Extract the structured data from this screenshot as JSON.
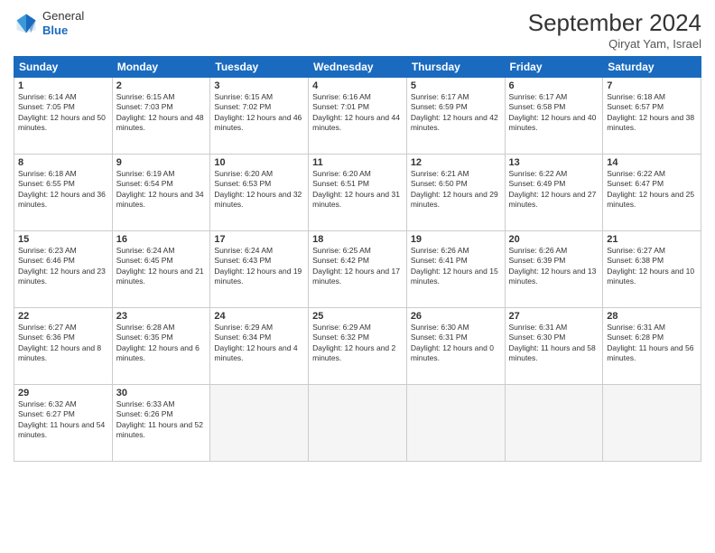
{
  "header": {
    "logo_line1": "General",
    "logo_line2": "Blue",
    "title": "September 2024",
    "subtitle": "Qiryat Yam, Israel"
  },
  "days_of_week": [
    "Sunday",
    "Monday",
    "Tuesday",
    "Wednesday",
    "Thursday",
    "Friday",
    "Saturday"
  ],
  "weeks": [
    [
      {
        "day": "1",
        "rise": "6:14 AM",
        "set": "7:05 PM",
        "daylight": "12 hours and 50 minutes."
      },
      {
        "day": "2",
        "rise": "6:15 AM",
        "set": "7:03 PM",
        "daylight": "12 hours and 48 minutes."
      },
      {
        "day": "3",
        "rise": "6:15 AM",
        "set": "7:02 PM",
        "daylight": "12 hours and 46 minutes."
      },
      {
        "day": "4",
        "rise": "6:16 AM",
        "set": "7:01 PM",
        "daylight": "12 hours and 44 minutes."
      },
      {
        "day": "5",
        "rise": "6:17 AM",
        "set": "6:59 PM",
        "daylight": "12 hours and 42 minutes."
      },
      {
        "day": "6",
        "rise": "6:17 AM",
        "set": "6:58 PM",
        "daylight": "12 hours and 40 minutes."
      },
      {
        "day": "7",
        "rise": "6:18 AM",
        "set": "6:57 PM",
        "daylight": "12 hours and 38 minutes."
      }
    ],
    [
      {
        "day": "8",
        "rise": "6:18 AM",
        "set": "6:55 PM",
        "daylight": "12 hours and 36 minutes."
      },
      {
        "day": "9",
        "rise": "6:19 AM",
        "set": "6:54 PM",
        "daylight": "12 hours and 34 minutes."
      },
      {
        "day": "10",
        "rise": "6:20 AM",
        "set": "6:53 PM",
        "daylight": "12 hours and 32 minutes."
      },
      {
        "day": "11",
        "rise": "6:20 AM",
        "set": "6:51 PM",
        "daylight": "12 hours and 31 minutes."
      },
      {
        "day": "12",
        "rise": "6:21 AM",
        "set": "6:50 PM",
        "daylight": "12 hours and 29 minutes."
      },
      {
        "day": "13",
        "rise": "6:22 AM",
        "set": "6:49 PM",
        "daylight": "12 hours and 27 minutes."
      },
      {
        "day": "14",
        "rise": "6:22 AM",
        "set": "6:47 PM",
        "daylight": "12 hours and 25 minutes."
      }
    ],
    [
      {
        "day": "15",
        "rise": "6:23 AM",
        "set": "6:46 PM",
        "daylight": "12 hours and 23 minutes."
      },
      {
        "day": "16",
        "rise": "6:24 AM",
        "set": "6:45 PM",
        "daylight": "12 hours and 21 minutes."
      },
      {
        "day": "17",
        "rise": "6:24 AM",
        "set": "6:43 PM",
        "daylight": "12 hours and 19 minutes."
      },
      {
        "day": "18",
        "rise": "6:25 AM",
        "set": "6:42 PM",
        "daylight": "12 hours and 17 minutes."
      },
      {
        "day": "19",
        "rise": "6:26 AM",
        "set": "6:41 PM",
        "daylight": "12 hours and 15 minutes."
      },
      {
        "day": "20",
        "rise": "6:26 AM",
        "set": "6:39 PM",
        "daylight": "12 hours and 13 minutes."
      },
      {
        "day": "21",
        "rise": "6:27 AM",
        "set": "6:38 PM",
        "daylight": "12 hours and 10 minutes."
      }
    ],
    [
      {
        "day": "22",
        "rise": "6:27 AM",
        "set": "6:36 PM",
        "daylight": "12 hours and 8 minutes."
      },
      {
        "day": "23",
        "rise": "6:28 AM",
        "set": "6:35 PM",
        "daylight": "12 hours and 6 minutes."
      },
      {
        "day": "24",
        "rise": "6:29 AM",
        "set": "6:34 PM",
        "daylight": "12 hours and 4 minutes."
      },
      {
        "day": "25",
        "rise": "6:29 AM",
        "set": "6:32 PM",
        "daylight": "12 hours and 2 minutes."
      },
      {
        "day": "26",
        "rise": "6:30 AM",
        "set": "6:31 PM",
        "daylight": "12 hours and 0 minutes."
      },
      {
        "day": "27",
        "rise": "6:31 AM",
        "set": "6:30 PM",
        "daylight": "11 hours and 58 minutes."
      },
      {
        "day": "28",
        "rise": "6:31 AM",
        "set": "6:28 PM",
        "daylight": "11 hours and 56 minutes."
      }
    ],
    [
      {
        "day": "29",
        "rise": "6:32 AM",
        "set": "6:27 PM",
        "daylight": "11 hours and 54 minutes."
      },
      {
        "day": "30",
        "rise": "6:33 AM",
        "set": "6:26 PM",
        "daylight": "11 hours and 52 minutes."
      },
      null,
      null,
      null,
      null,
      null
    ]
  ]
}
